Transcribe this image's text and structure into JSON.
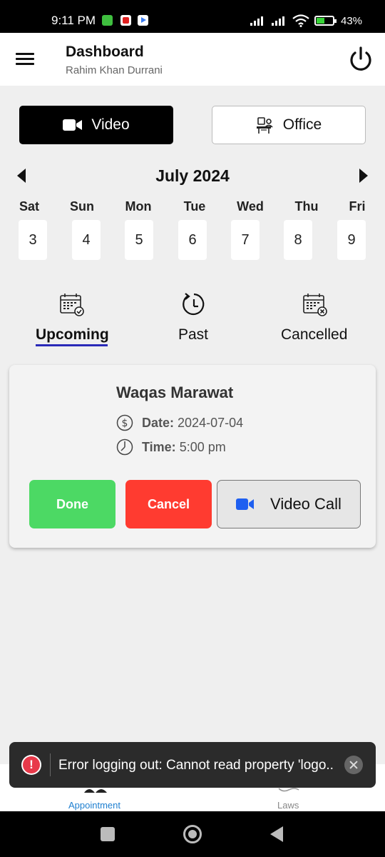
{
  "status_bar": {
    "time": "9:11 PM",
    "battery": "43%"
  },
  "header": {
    "title": "Dashboard",
    "subtitle": "Rahim Khan Durrani"
  },
  "mode_toggle": {
    "video_label": "Video",
    "office_label": "Office",
    "selected": "Video"
  },
  "calendar": {
    "month": "July 2024",
    "days": [
      {
        "name": "Sat",
        "date": "3"
      },
      {
        "name": "Sun",
        "date": "4"
      },
      {
        "name": "Mon",
        "date": "5"
      },
      {
        "name": "Tue",
        "date": "6"
      },
      {
        "name": "Wed",
        "date": "7"
      },
      {
        "name": "Thu",
        "date": "8"
      },
      {
        "name": "Fri",
        "date": "9"
      }
    ]
  },
  "tabs": [
    {
      "label": "Upcoming",
      "icon": "calendar-check-icon",
      "active": true
    },
    {
      "label": "Past",
      "icon": "clock-history-icon",
      "active": false
    },
    {
      "label": "Cancelled",
      "icon": "calendar-cancel-icon",
      "active": false
    }
  ],
  "appointment": {
    "name": "Waqas Marawat",
    "date_label": "Date:",
    "date": "2024-07-04",
    "time_label": "Time:",
    "time": "5:00 pm",
    "done_label": "Done",
    "cancel_label": "Cancel",
    "video_call_label": "Video Call"
  },
  "bottom_nav": {
    "items": [
      {
        "label": "Appointment",
        "active": true
      },
      {
        "label": "Laws",
        "active": false
      }
    ]
  },
  "toast": {
    "message": "Error logging out: Cannot read property 'logo..."
  },
  "colors": {
    "accent": "#2a2ab8",
    "done": "#4cd964",
    "cancel": "#ff3b30",
    "nav_active": "#1e7fd0",
    "video_icon": "#1e5ff0"
  }
}
